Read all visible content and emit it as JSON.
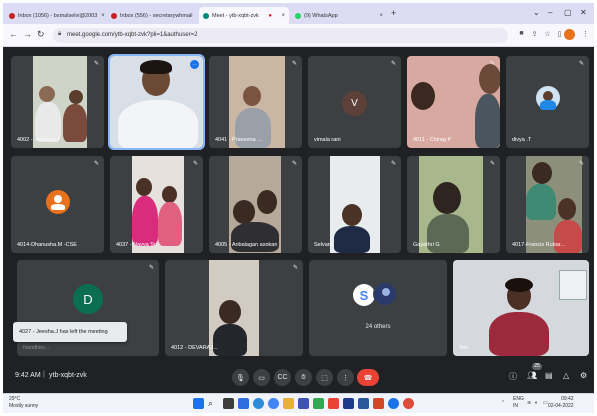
{
  "browser": {
    "tabs": [
      {
        "label": "Inbox (1056) - bsmalselvi@2003",
        "color": "#c5221f"
      },
      {
        "label": "Inbox (556) - secretarywhmail",
        "color": "#c5221f"
      },
      {
        "label": "Meet - ytb-xqbt-zvk",
        "color": "#00897b"
      },
      {
        "label": "(9) WhatsApp",
        "color": "#25d366"
      }
    ],
    "url": "meet.google.com/ytb-xqbt-zvk?pli=1&authuser=2"
  },
  "participants": [
    {
      "name": "4002 - Jansana.J"
    },
    {
      "name": ""
    },
    {
      "name": "4041 - Praveena ..."
    },
    {
      "name": "vimala rani",
      "initial": "V",
      "avatar_color": "#5d4037"
    },
    {
      "name": "4011 - Chirag P"
    },
    {
      "name": "divya .T"
    },
    {
      "name": "4014-Dhanusha.M -CSE"
    },
    {
      "name": "4037 - Navya Sri"
    },
    {
      "name": "4005 - Anbalagan asokan"
    },
    {
      "name": "Selvam"
    },
    {
      "name": "Gayathri G"
    },
    {
      "name": "4017-Francis Rubar..."
    },
    {
      "name": "Nandhini...",
      "initial": "D",
      "avatar_color": "#0b6e4f"
    },
    {
      "name": "4012 - DEVARAJ..."
    },
    {
      "name": "24 others"
    },
    {
      "name": "You"
    }
  ],
  "toast": "4027 - Jeesha.J has left the meeting",
  "meetbar": {
    "time": "9:42 AM",
    "code": "ytb-xqbt-zvk",
    "badge": "25"
  },
  "taskbar": {
    "weather_temp": "29°C",
    "weather_desc": "Mostly sunny",
    "lang1": "ENG",
    "lang2": "IN",
    "time": "09:42",
    "date": "02-04-2022"
  }
}
